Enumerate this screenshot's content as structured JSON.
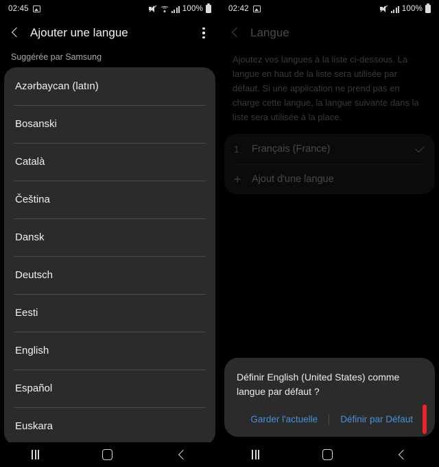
{
  "left": {
    "status_bar": {
      "time": "02:45",
      "photo_icon": "photo-icon",
      "mute_icon": "mute-icon",
      "wifi_icon": "wifi-icon",
      "signal_icon": "signal-icon",
      "battery_percent": "100%",
      "battery_icon": "battery-icon"
    },
    "appbar": {
      "back_icon": "back-chevron-icon",
      "title": "Ajouter une langue",
      "menu_icon": "kebab-menu-icon"
    },
    "section_label": "Suggérée par Samsung",
    "languages": [
      "Azərbaycan (latın)",
      "Bosanski",
      "Català",
      "Čeština",
      "Dansk",
      "Deutsch",
      "Eesti",
      "English",
      "Español",
      "Euskara"
    ],
    "navbar": {
      "recents": "recents-icon",
      "home": "home-icon",
      "back": "back-icon"
    }
  },
  "right": {
    "status_bar": {
      "time": "02:42",
      "photo_icon": "photo-icon",
      "mute_icon": "mute-icon",
      "signal_icon": "signal-icon",
      "battery_percent": "100%",
      "battery_icon": "battery-icon"
    },
    "appbar": {
      "back_icon": "back-chevron-icon",
      "title": "Langue"
    },
    "description": "Ajoutez vos langues à la liste ci-dessous. La langue en haut de la liste sera utilisée par défaut. Si une application ne prend pas en charge cette langue, la langue suivante dans la liste sera utilisée à la place.",
    "language_list": [
      {
        "index": "1",
        "label": "Français (France)",
        "checked": true
      }
    ],
    "add_language": {
      "plus_icon": "plus-icon",
      "label": "Ajout d'une langue"
    },
    "dialog": {
      "message": "Définir English (United States) comme langue par défaut ?",
      "keep_button": "Garder l'actuelle",
      "set_default_button": "Définir par Défaut",
      "highlight_color": "#e8242a",
      "button_color": "#4a90d9"
    },
    "navbar": {
      "recents": "recents-icon",
      "home": "home-icon",
      "back": "back-icon"
    }
  }
}
